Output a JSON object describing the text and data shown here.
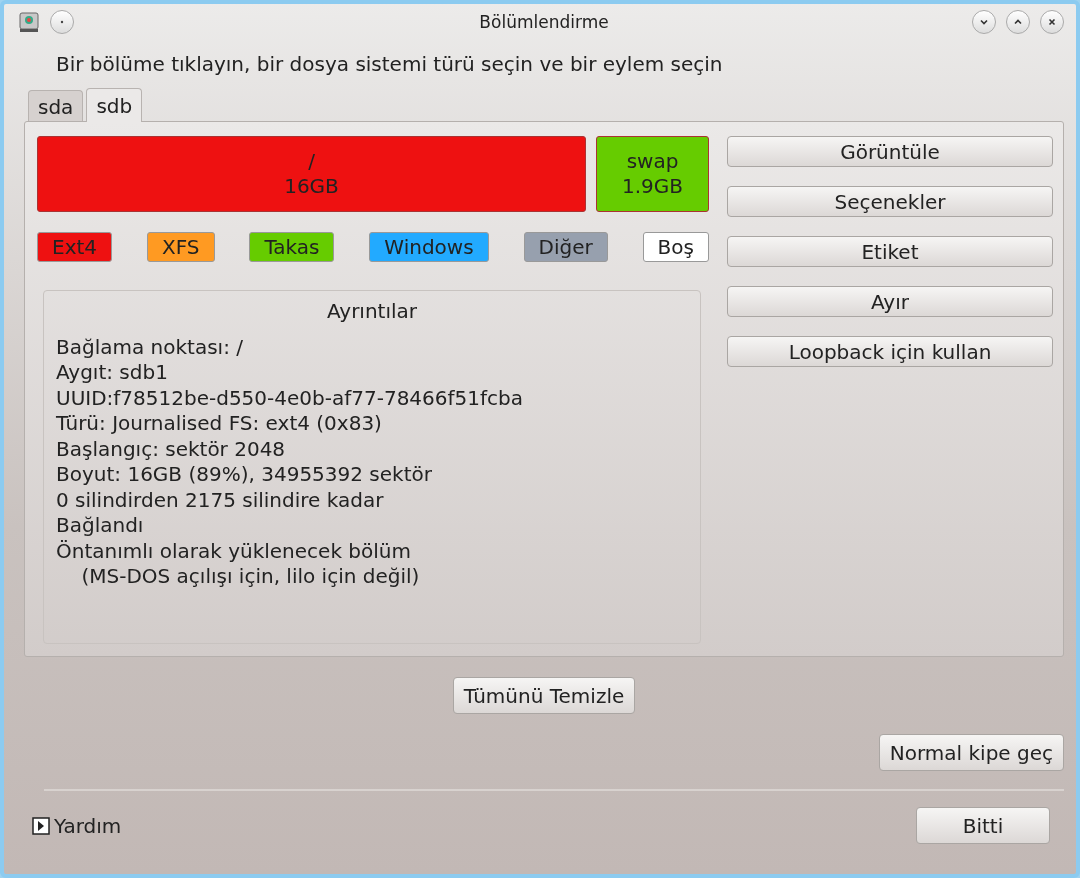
{
  "window": {
    "title": "Bölümlendirme"
  },
  "instruction": "Bir bölüme tıklayın, bir dosya sistemi türü seçin ve bir eylem seçin",
  "tabs": [
    {
      "label": "sda",
      "selected": false
    },
    {
      "label": "sdb",
      "selected": true
    }
  ],
  "partitions": [
    {
      "mount": "/",
      "size": "16GB",
      "color": "#ee1111"
    },
    {
      "mount": "swap",
      "size": "1.9GB",
      "color": "#66cc00"
    }
  ],
  "legend": [
    {
      "label": "Ext4",
      "color": "#ee1111"
    },
    {
      "label": "XFS",
      "color": "#ff9a22"
    },
    {
      "label": "Takas",
      "color": "#66cc00"
    },
    {
      "label": "Windows",
      "color": "#22aaff"
    },
    {
      "label": "Diğer",
      "color": "#97a0ae"
    },
    {
      "label": "Boş",
      "color": "#ffffff"
    }
  ],
  "details": {
    "title": "Ayrıntılar",
    "lines": [
      "Bağlama noktası: /",
      "Aygıt: sdb1",
      "UUID:f78512be-d550-4e0b-af77-78466f51fcba",
      "Türü: Journalised FS: ext4 (0x83)",
      "Başlangıç: sektör 2048",
      "Boyut: 16GB (89%), 34955392 sektör",
      "0 silindirden 2175 silindire kadar",
      "Bağlandı",
      "Öntanımlı olarak yüklenecek bölüm",
      "    (MS-DOS açılışı için, lilo için değil)"
    ]
  },
  "actions": [
    "Görüntüle",
    "Seçenekler",
    "Etiket",
    "Ayır",
    "Loopback için kullan"
  ],
  "clear_button": "Tümünü Temizle",
  "mode_button": "Normal kipe geç",
  "help": {
    "label": "Yardım",
    "expanded": false
  },
  "done_button": "Bitti"
}
